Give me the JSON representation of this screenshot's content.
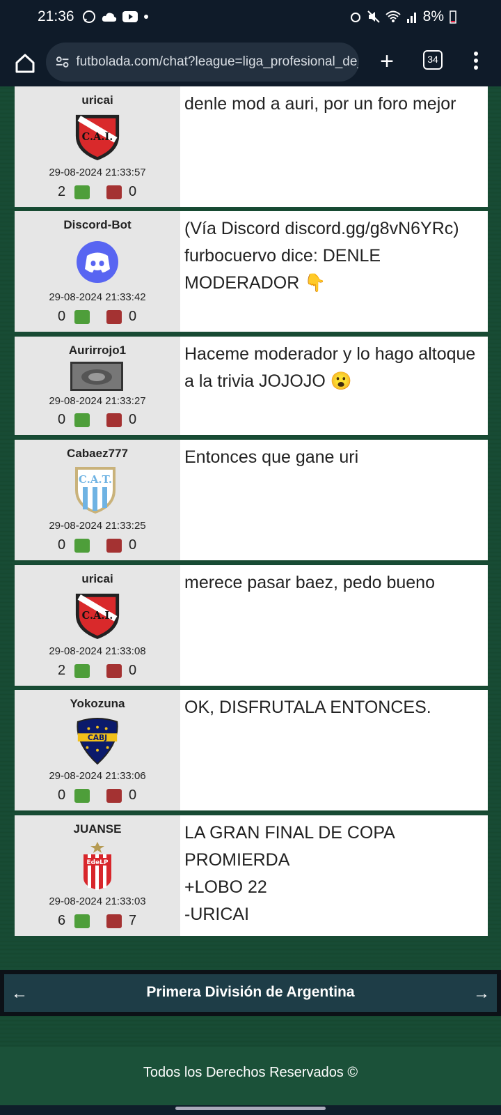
{
  "status": {
    "time": "21:36",
    "battery": "8%"
  },
  "browser": {
    "url": "futbolada.com/chat?league=liga_profesional_de_f",
    "tab_count": "34"
  },
  "messages": [
    {
      "user": "uricai",
      "badge": "independiente",
      "timestamp": "29-08-2024 21:33:57",
      "up": "2",
      "down": "0",
      "text": "denle mod a auri, por un foro mejor"
    },
    {
      "user": "Discord-Bot",
      "badge": "discord",
      "timestamp": "29-08-2024 21:33:42",
      "up": "0",
      "down": "0",
      "text": "(Vía Discord discord.gg/g8vN6YRc) furbocuervo dice: DENLE MODERADOR 👇"
    },
    {
      "user": "Aurirrojo1",
      "badge": "photo",
      "timestamp": "29-08-2024 21:33:27",
      "up": "0",
      "down": "0",
      "text": "Haceme moderador y lo hago altoque a la trivia JOJOJO 😮"
    },
    {
      "user": "Cabaez777",
      "badge": "atletico-tucuman",
      "timestamp": "29-08-2024 21:33:25",
      "up": "0",
      "down": "0",
      "text": "Entonces que gane uri"
    },
    {
      "user": "uricai",
      "badge": "independiente",
      "timestamp": "29-08-2024 21:33:08",
      "up": "2",
      "down": "0",
      "text": "merece pasar baez, pedo bueno"
    },
    {
      "user": "Yokozuna",
      "badge": "boca-juniors",
      "timestamp": "29-08-2024 21:33:06",
      "up": "0",
      "down": "0",
      "text": "OK, DISFRUTALA ENTONCES."
    },
    {
      "user": "JUANSE",
      "badge": "estudiantes",
      "timestamp": "29-08-2024 21:33:03",
      "up": "6",
      "down": "7",
      "text": "LA GRAN FINAL DE COPA\nPROMIERDA\n+LOBO 22\n-URICAI"
    }
  ],
  "pager": {
    "label": "Primera División de Argentina",
    "prev": "←",
    "next": "→"
  },
  "footer": {
    "text": "Todos los Derechos Reservados ©"
  },
  "badge_text": {
    "cai": "C.A.I.",
    "cat": "C.A.T.",
    "cabj": "CABJ",
    "edelp": "EdeLP"
  }
}
